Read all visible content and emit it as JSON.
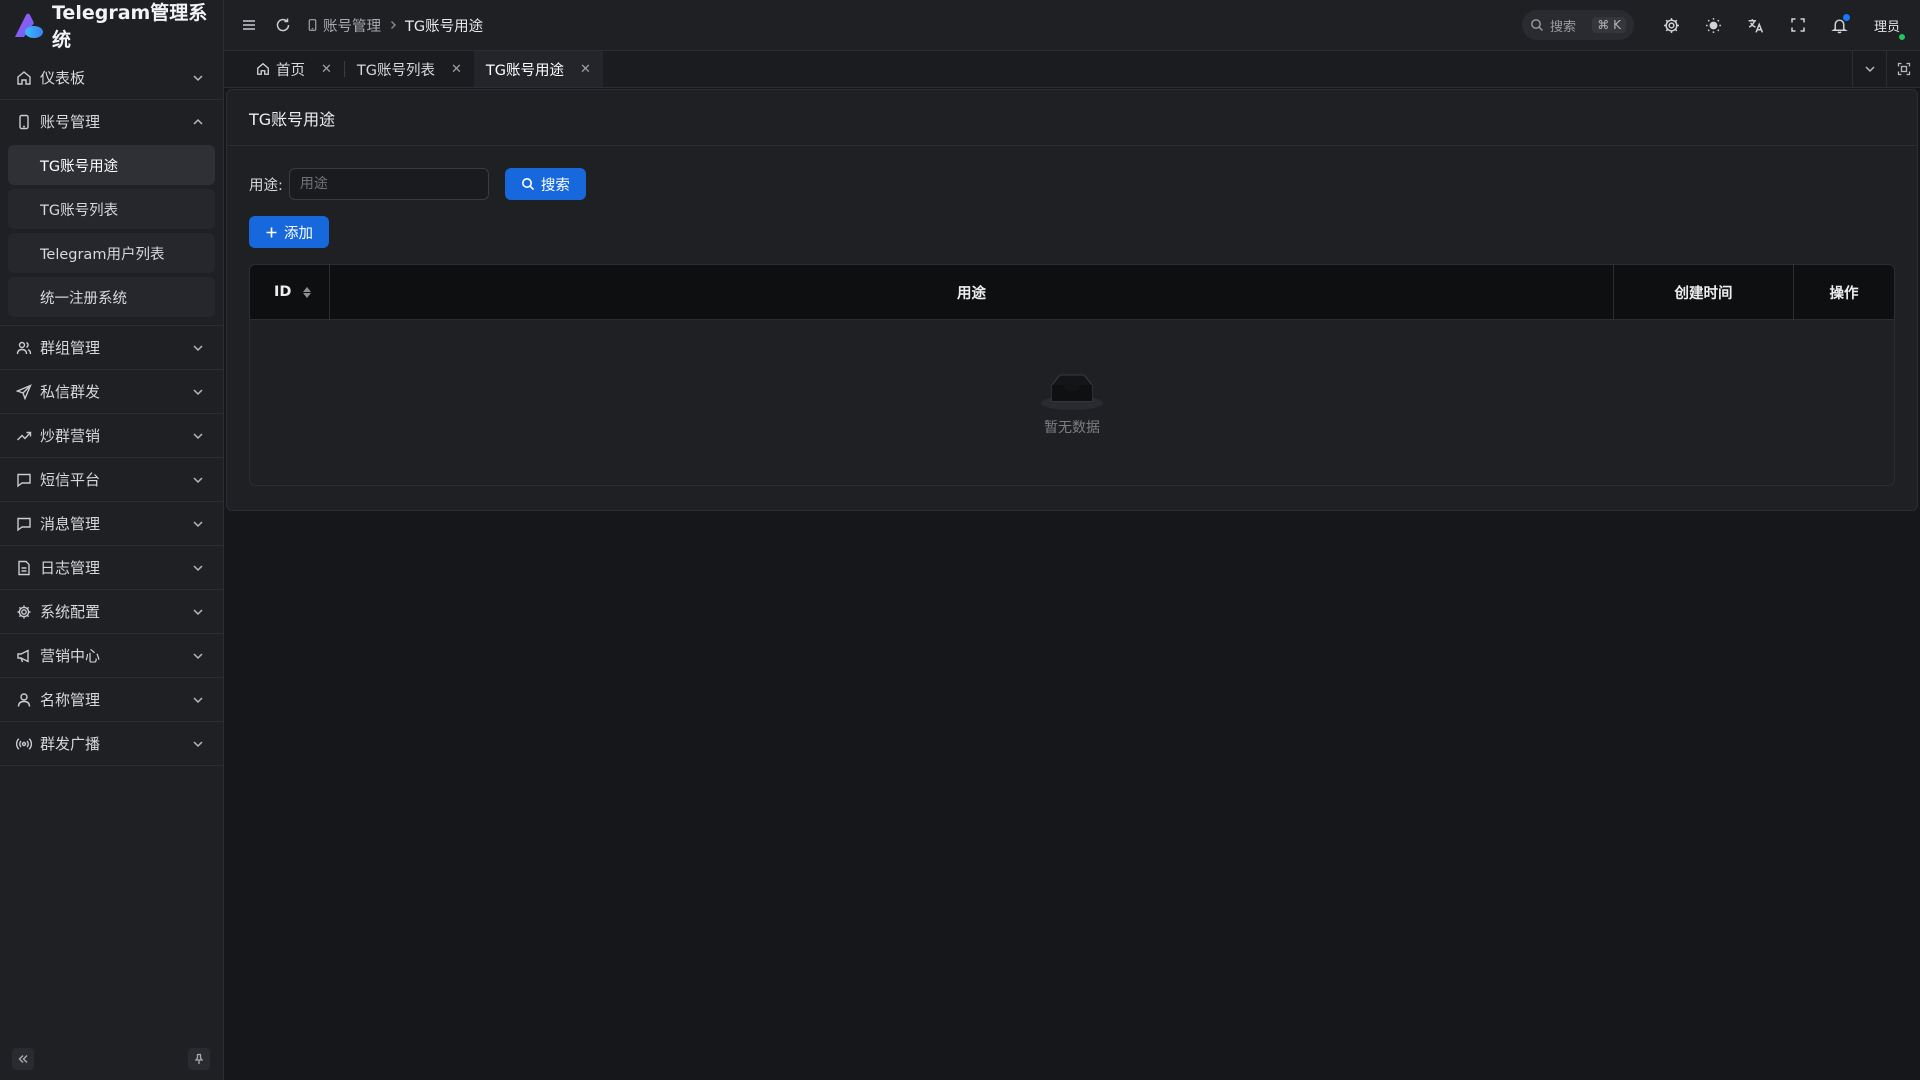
{
  "app": {
    "title": "Telegram管理系统"
  },
  "sidebar": {
    "items": [
      {
        "label": "仪表板",
        "icon": "home-icon",
        "expanded": false
      },
      {
        "label": "账号管理",
        "icon": "phone-icon",
        "expanded": true,
        "children": [
          {
            "label": "TG账号用途",
            "active": true
          },
          {
            "label": "TG账号列表"
          },
          {
            "label": "Telegram用户列表"
          },
          {
            "label": "统一注册系统"
          }
        ]
      },
      {
        "label": "群组管理",
        "icon": "users-icon"
      },
      {
        "label": "私信群发",
        "icon": "send-icon"
      },
      {
        "label": "炒群营销",
        "icon": "trending-icon"
      },
      {
        "label": "短信平台",
        "icon": "message-icon"
      },
      {
        "label": "消息管理",
        "icon": "message-icon"
      },
      {
        "label": "日志管理",
        "icon": "file-icon"
      },
      {
        "label": "系统配置",
        "icon": "gear-icon"
      },
      {
        "label": "营销中心",
        "icon": "megaphone-icon"
      },
      {
        "label": "名称管理",
        "icon": "user-icon"
      },
      {
        "label": "群发广播",
        "icon": "broadcast-icon"
      }
    ]
  },
  "header": {
    "breadcrumb": {
      "parent": "账号管理",
      "current": "TG账号用途"
    },
    "search": {
      "placeholder": "搜索",
      "shortcut": "⌘ K"
    },
    "user": "理员",
    "accent": "#1668dc"
  },
  "tabs": [
    {
      "label": "首页",
      "icon": "home-icon"
    },
    {
      "label": "TG账号列表"
    },
    {
      "label": "TG账号用途",
      "active": true
    }
  ],
  "page": {
    "title": "TG账号用途",
    "form": {
      "label": "用途:",
      "placeholder": "用途",
      "value": ""
    },
    "search_button": "搜索",
    "add_button": "添加",
    "table": {
      "columns": [
        "ID",
        "用途",
        "创建时间",
        "操作"
      ],
      "rows": [],
      "empty_text": "暂无数据"
    }
  }
}
